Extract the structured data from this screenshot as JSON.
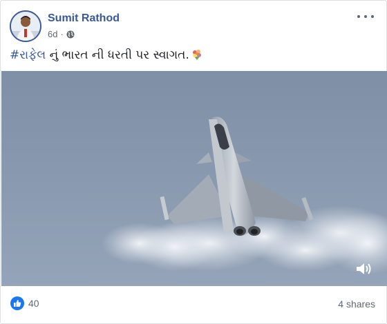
{
  "post": {
    "author": "Sumit Rathod",
    "time": "6d",
    "separator": "·",
    "caption_hashtag": "#રાફેલ",
    "caption_text": " નું ભારત ની ધરતી પર સ્વાગત.",
    "reaction_count": "40",
    "shares": "4 shares"
  },
  "icons": {
    "privacy": "globe-icon",
    "menu": "more-options-icon",
    "emoji": "bouquet-emoji",
    "volume": "volume-icon",
    "reaction": "like-icon"
  },
  "colors": {
    "link": "#385898",
    "like": "#1877f2",
    "muted": "#606770"
  }
}
